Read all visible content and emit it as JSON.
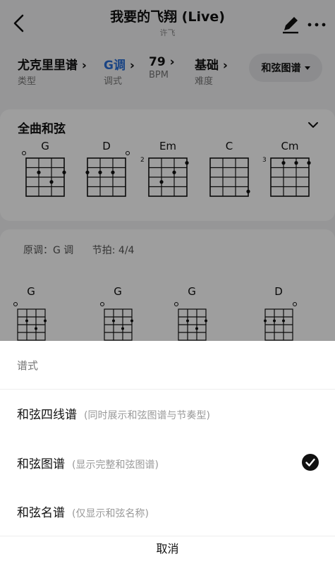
{
  "header": {
    "song_title": "我要的飞翔 (Live)",
    "singer": "许飞"
  },
  "meta": [
    {
      "value": "尤克里里谱",
      "label": "类型",
      "highlight": false
    },
    {
      "value": "G调",
      "label": "调式",
      "highlight": true
    },
    {
      "value": "79",
      "label": "BPM",
      "highlight": false
    },
    {
      "value": "基础",
      "label": "难度",
      "highlight": false
    }
  ],
  "view_mode_button": "和弦图谱",
  "all_chords": {
    "title": "全曲和弦",
    "chords": [
      {
        "name": "G",
        "fret_label": "",
        "open_string": "1"
      },
      {
        "name": "D",
        "fret_label": "",
        "open_string": "4"
      },
      {
        "name": "Em",
        "fret_label": "2",
        "open_string": ""
      },
      {
        "name": "C",
        "fret_label": "",
        "open_string": ""
      },
      {
        "name": "Cm",
        "fret_label": "3",
        "open_string": ""
      }
    ]
  },
  "sheet_info": {
    "original_key": "原调：G 调",
    "time_signature": "节拍: 4/4"
  },
  "sheet_chords": [
    {
      "name": "G"
    },
    {
      "name": "G"
    },
    {
      "name": "G"
    },
    {
      "name": "D"
    }
  ],
  "bottom_sheet": {
    "title": "谱式",
    "options": [
      {
        "label": "和弦四线谱",
        "desc": "(同时展示和弦图谱与节奏型)",
        "selected": false
      },
      {
        "label": "和弦图谱",
        "desc": "(显示完整和弦图谱)",
        "selected": true
      },
      {
        "label": "和弦名谱",
        "desc": "(仅显示和弦名称)",
        "selected": false
      }
    ],
    "cancel": "取消"
  },
  "colors": {
    "accent": "#2a6fd6",
    "check": "#111111"
  },
  "icons": {
    "back": "chevron-left-icon",
    "edit": "pencil-icon",
    "more": "more-horizontal-icon",
    "collapse": "chevron-down-icon",
    "selected": "check-circle-icon"
  }
}
